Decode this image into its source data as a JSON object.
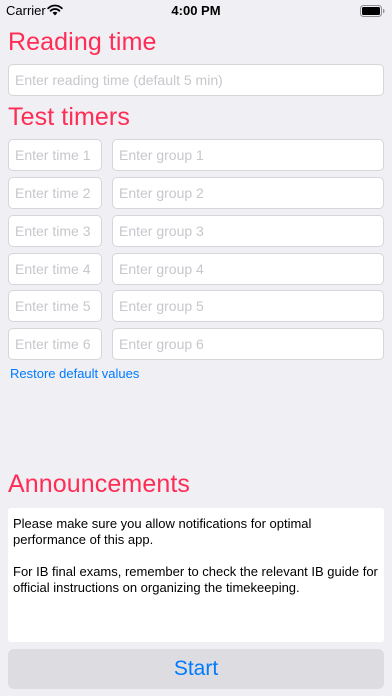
{
  "status_bar": {
    "carrier": "Carrier",
    "time": "4:00 PM",
    "wifi_icon": "wifi-icon",
    "battery_icon": "battery-full-icon"
  },
  "reading": {
    "title": "Reading time",
    "placeholder": "Enter reading time (default 5 min)"
  },
  "timers": {
    "title": "Test timers",
    "rows": [
      {
        "time_placeholder": "Enter time 1",
        "group_placeholder": "Enter group 1"
      },
      {
        "time_placeholder": "Enter time 2",
        "group_placeholder": "Enter group 2"
      },
      {
        "time_placeholder": "Enter time 3",
        "group_placeholder": "Enter group 3"
      },
      {
        "time_placeholder": "Enter time 4",
        "group_placeholder": "Enter group 4"
      },
      {
        "time_placeholder": "Enter time 5",
        "group_placeholder": "Enter group 5"
      },
      {
        "time_placeholder": "Enter time 6",
        "group_placeholder": "Enter group 6"
      }
    ],
    "restore_label": "Restore default values"
  },
  "announcements": {
    "title": "Announcements",
    "paragraphs": [
      "Please make sure you allow notifications for optimal performance of this app.",
      "For IB final exams, remember to check the relevant IB guide for official instructions on organizing the timekeeping."
    ]
  },
  "start_label": "Start",
  "colors": {
    "accent_title": "#ff2d55",
    "link_blue": "#007aff",
    "background": "#efeff4"
  }
}
